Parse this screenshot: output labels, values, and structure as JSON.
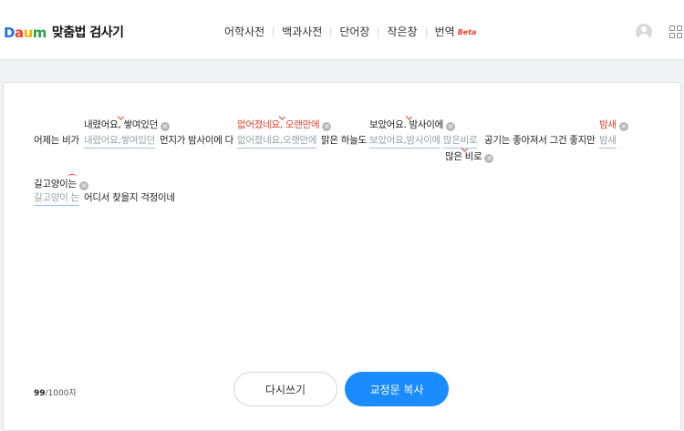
{
  "header": {
    "logo_text": "Daum",
    "title": "맞춤법 검사기",
    "nav": [
      {
        "label": "어학사전"
      },
      {
        "label": "백과사전"
      },
      {
        "label": "단어장"
      },
      {
        "label": "작은창"
      },
      {
        "label": "번역",
        "badge": "Beta"
      }
    ],
    "avatar_icon": "user-icon",
    "apps_icon": "grid-icon"
  },
  "editor": {
    "plain": {
      "p1": "어제는 비가",
      "p2": "먼지가 밤사이에 다",
      "p3": "맑은 하늘도",
      "p4": "공기는 좋아져서 그건 좋지만",
      "p5": "어디서 찾을지 걱정이네"
    },
    "errors": {
      "e1": "내렸어요,쌓여있던",
      "e2": "없어졌네요,오랫만에",
      "e3": "보았어요,밤사이에",
      "e4": "많은비로",
      "e5": "밤새",
      "e6": "길고양이 는"
    },
    "suggestions": {
      "s1": "내렸어요, 쌓여있던",
      "s2": "없어졌네요, 오랜만에",
      "s3": "보았어요. 밤사이에",
      "s4": "많은 비로",
      "s5": "밤새",
      "s6": "길고양이는"
    },
    "remove_icon": "close-circle-icon"
  },
  "footer": {
    "count_current": "99",
    "count_limit": "/1000자",
    "reset_label": "다시쓰기",
    "copy_label": "교정문 복사"
  },
  "colors": {
    "accent": "#1a8cff",
    "error_red": "#e8412b",
    "underline": "#9ec1ee"
  }
}
